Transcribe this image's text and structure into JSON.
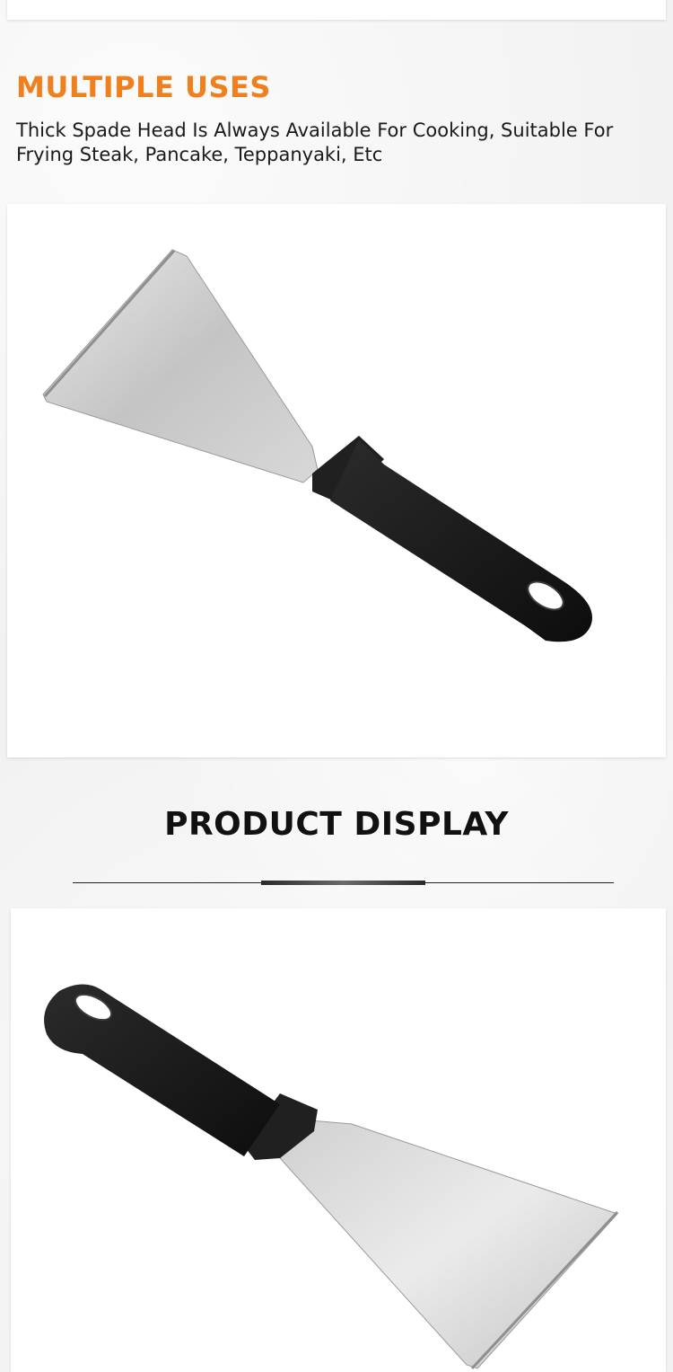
{
  "multiple_uses": {
    "heading": "MULTIPLE USES",
    "description": "Thick Spade Head Is Always Available For Cooking, Suitable For Frying Steak, Pancake, Teppanyaki, Etc"
  },
  "product_display": {
    "heading": "PRODUCT DISPLAY"
  },
  "photos": [
    {
      "subject": "spatula-photo-blade-left"
    },
    {
      "subject": "spatula-photo-blade-right"
    }
  ],
  "colors": {
    "accent_orange": "#f0801e",
    "heading_dark": "#111111",
    "text": "#1a1a1a",
    "handle_black": "#1a1a1a",
    "blade_steel": "#cfcfcf",
    "background": "#f2f2f2"
  }
}
